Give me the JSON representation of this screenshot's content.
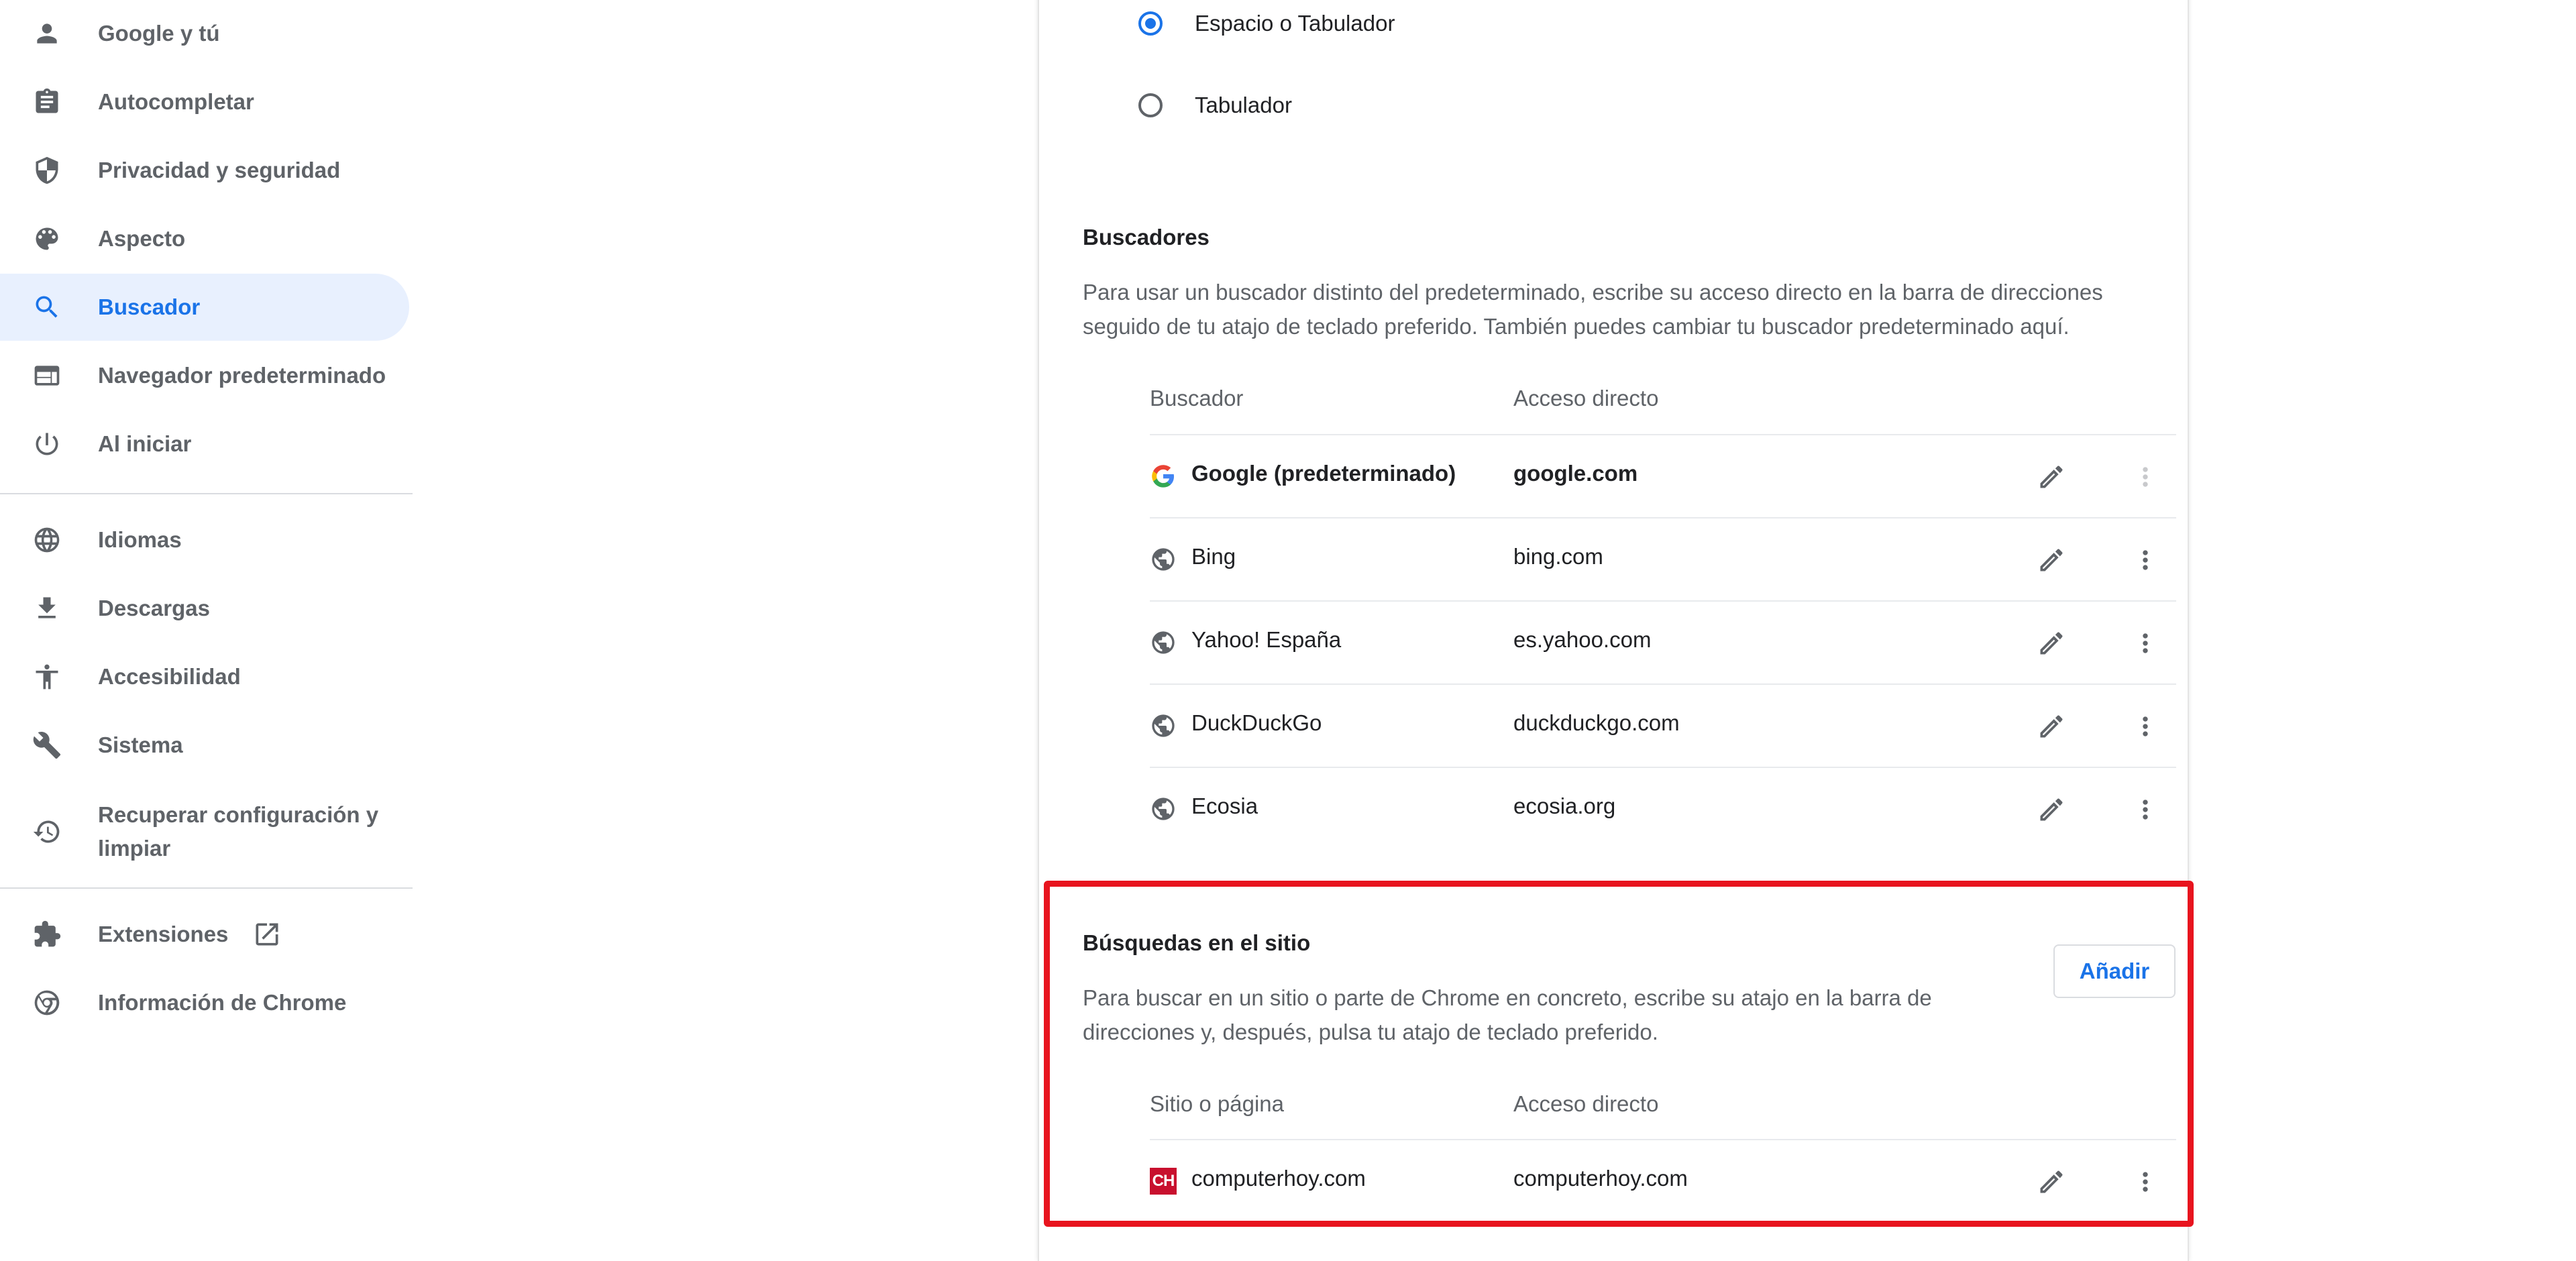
{
  "sidebar": {
    "items": [
      {
        "label": "Google y tú",
        "icon": "person-icon"
      },
      {
        "label": "Autocompletar",
        "icon": "clipboard-icon"
      },
      {
        "label": "Privacidad y seguridad",
        "icon": "shield-icon"
      },
      {
        "label": "Aspecto",
        "icon": "palette-icon"
      },
      {
        "label": "Buscador",
        "icon": "search-icon",
        "active": true
      },
      {
        "label": "Navegador predeterminado",
        "icon": "browser-icon"
      },
      {
        "label": "Al iniciar",
        "icon": "power-icon"
      },
      {
        "label": "Idiomas",
        "icon": "globe-icon"
      },
      {
        "label": "Descargas",
        "icon": "download-icon"
      },
      {
        "label": "Accesibilidad",
        "icon": "accessibility-icon"
      },
      {
        "label": "Sistema",
        "icon": "wrench-icon"
      },
      {
        "label": "Recuperar configuración y limpiar",
        "icon": "restore-icon"
      },
      {
        "label": "Extensiones",
        "icon": "puzzle-icon",
        "external": "open-in-new-icon"
      },
      {
        "label": "Información de Chrome",
        "icon": "chrome-icon"
      }
    ]
  },
  "shortcut_options": {
    "selected": "Espacio o Tabulador",
    "options": [
      "Espacio o Tabulador",
      "Tabulador"
    ]
  },
  "search_engines": {
    "title": "Buscadores",
    "description": "Para usar un buscador distinto del predeterminado, escribe su acceso directo en la barra de direcciones seguido de tu atajo de teclado preferido. También puedes cambiar tu buscador predeterminado aquí.",
    "col_engine": "Buscador",
    "col_shortcut": "Acceso directo",
    "rows": [
      {
        "name": "Google (predeterminado)",
        "shortcut": "google.com",
        "icon": "google-g-icon",
        "default": true
      },
      {
        "name": "Bing",
        "shortcut": "bing.com",
        "icon": "globe-icon"
      },
      {
        "name": "Yahoo! España",
        "shortcut": "es.yahoo.com",
        "icon": "globe-icon"
      },
      {
        "name": "DuckDuckGo",
        "shortcut": "duckduckgo.com",
        "icon": "globe-icon"
      },
      {
        "name": "Ecosia",
        "shortcut": "ecosia.org",
        "icon": "globe-icon"
      }
    ]
  },
  "site_search": {
    "title": "Búsquedas en el sitio",
    "description": "Para buscar en un sitio o parte de Chrome en concreto, escribe su atajo en la barra de direcciones y, después, pulsa tu atajo de teclado preferido.",
    "add_label": "Añadir",
    "col_site": "Sitio o página",
    "col_shortcut": "Acceso directo",
    "rows": [
      {
        "name": "computerhoy.com",
        "shortcut": "computerhoy.com",
        "logo_text": "CH"
      }
    ]
  },
  "colors": {
    "accent": "#1a73e8",
    "highlight_border": "#e8141e",
    "active_nav_bg": "#e8f0fe",
    "computerhoy_brand": "#c8102e"
  }
}
